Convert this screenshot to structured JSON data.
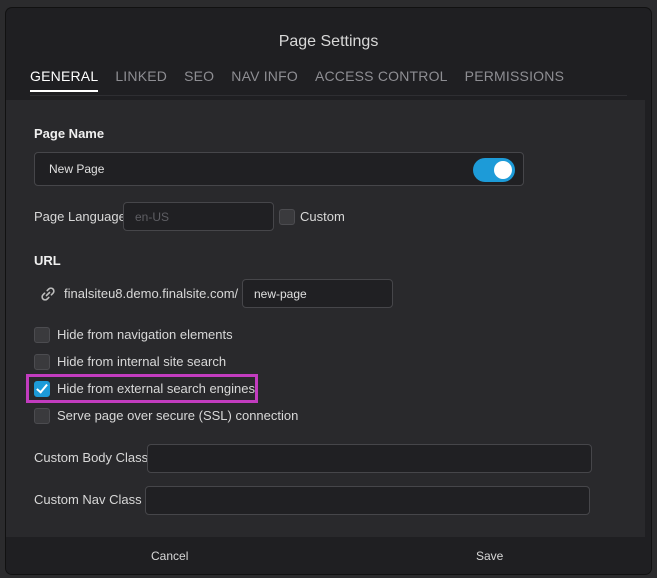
{
  "dialog": {
    "title": "Page Settings"
  },
  "tabs": [
    {
      "label": "GENERAL",
      "active": true
    },
    {
      "label": "LINKED",
      "active": false
    },
    {
      "label": "SEO",
      "active": false
    },
    {
      "label": "NAV INFO",
      "active": false
    },
    {
      "label": "ACCESS CONTROL",
      "active": false
    },
    {
      "label": "PERMISSIONS",
      "active": false
    }
  ],
  "page_name": {
    "heading": "Page Name",
    "value": "New Page",
    "toggle_on": true
  },
  "page_language": {
    "label": "Page Language",
    "placeholder": "en-US",
    "custom_label": "Custom",
    "custom_checked": false
  },
  "url": {
    "heading": "URL",
    "prefix": "finalsiteu8.demo.finalsite.com/",
    "slug": "new-page"
  },
  "options": [
    {
      "label": "Hide from navigation elements",
      "checked": false
    },
    {
      "label": "Hide from internal site search",
      "checked": false
    },
    {
      "label": "Hide from external search engines",
      "checked": true
    },
    {
      "label": "Serve page over secure (SSL) connection",
      "checked": false
    }
  ],
  "custom_body_class": {
    "label": "Custom Body Class",
    "value": ""
  },
  "custom_nav_class": {
    "label": "Custom Nav Class",
    "value": ""
  },
  "footer": {
    "cancel_label": "Cancel",
    "save_label": "Save"
  },
  "colors": {
    "accent": "#1d9bd8",
    "highlight": "#c23cbf",
    "background": "#1f1f22"
  }
}
